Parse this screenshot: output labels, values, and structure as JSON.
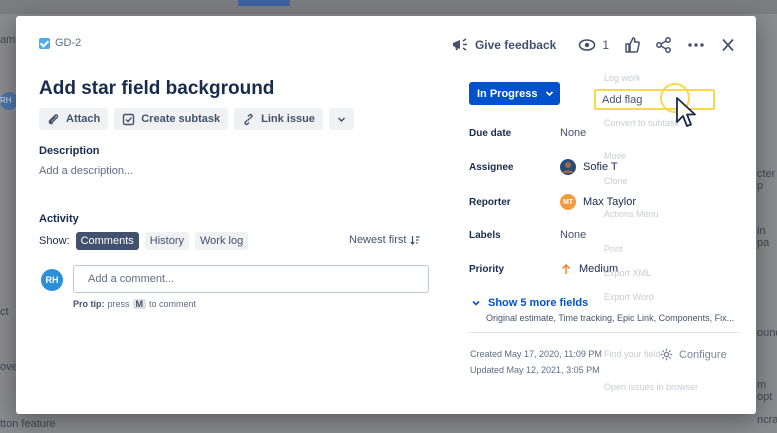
{
  "background": {
    "texts": [
      "am",
      "RH",
      "ct",
      "ove",
      "tton feature",
      "cter p",
      "in pa",
      "ounda",
      "m opt",
      "ncra"
    ]
  },
  "issue": {
    "key": "GD-2",
    "title": "Add star field background"
  },
  "topbar": {
    "feedback_label": "Give feedback",
    "watch_count": "1"
  },
  "actions": {
    "attach": "Attach",
    "create_subtask": "Create subtask",
    "link_issue": "Link issue"
  },
  "description": {
    "label": "Description",
    "placeholder": "Add a description..."
  },
  "activity": {
    "label": "Activity",
    "show_label": "Show:",
    "filters": [
      "Comments",
      "History",
      "Work log"
    ],
    "sort_label": "Newest first",
    "avatar_initials": "RH",
    "comment_placeholder": "Add a comment...",
    "protip_prefix": "Pro tip:",
    "protip_press": "press",
    "protip_key": "M",
    "protip_suffix": "to comment"
  },
  "details": {
    "status": "In Progress",
    "fields": [
      {
        "label": "Due date",
        "value": "None"
      },
      {
        "label": "Assignee",
        "value": "Sofie T"
      },
      {
        "label": "Reporter",
        "value": "Max Taylor",
        "initials": "MT"
      },
      {
        "label": "Labels",
        "value": "None"
      },
      {
        "label": "Priority",
        "value": "Medium"
      }
    ],
    "show_more": "Show 5 more fields",
    "more_fields_list": "Original estimate, Time tracking, Epic Link, Components, Fix...",
    "created": "Created May 17, 2020, 11:09 PM",
    "updated": "Updated May 12, 2021, 3:05 PM",
    "configure": "Configure"
  },
  "menu": {
    "add_flag": "Add flag",
    "ghost_items": [
      "Log work",
      "Convert to subtask",
      "Move",
      "Clone",
      "Actions Menu",
      "Print",
      "Export XML",
      "Export Word",
      "Find your field",
      "Open issues in browser"
    ]
  },
  "colors": {
    "primary": "#0052cc",
    "highlight": "#f7d94a",
    "assignee_avatar": "#2c4a7a",
    "reporter_avatar": "#f59a3c",
    "priority_arrow": "#f58a3c"
  }
}
